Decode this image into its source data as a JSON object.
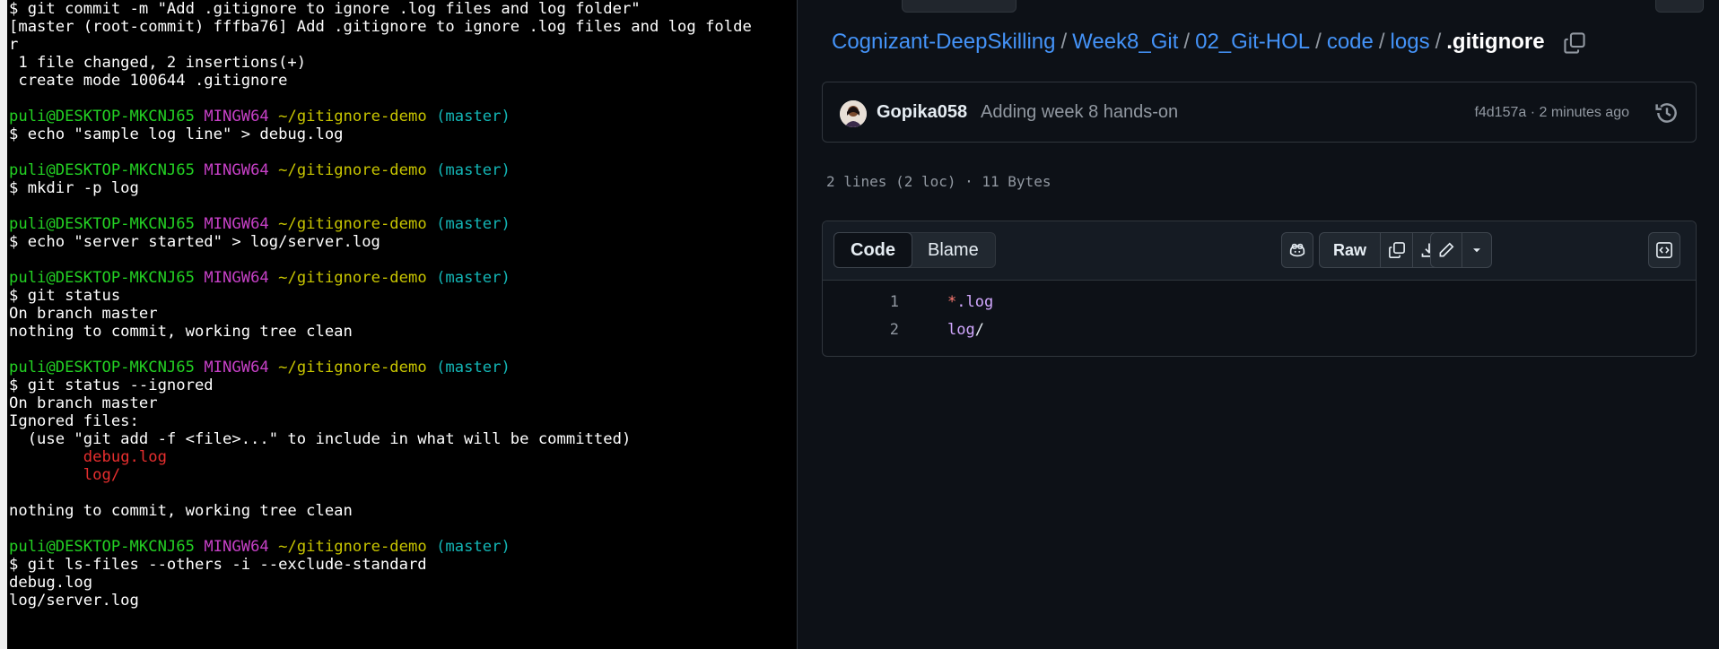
{
  "terminal": {
    "lines": [
      [
        {
          "t": "$ git commit -m \"Add .gitignore to ignore .log files and log folder\"",
          "c": ""
        }
      ],
      [
        {
          "t": "[master (root-commit) fffba76] Add .gitignore to ignore .log files and log folde",
          "c": ""
        }
      ],
      [
        {
          "t": "r",
          "c": ""
        }
      ],
      [
        {
          "t": " 1 file changed, 2 insertions(+)",
          "c": ""
        }
      ],
      [
        {
          "t": " create mode 100644 .gitignore",
          "c": ""
        }
      ],
      [],
      [
        {
          "t": "puli@DESKTOP-MKCNJ65",
          "c": "g"
        },
        {
          "t": " ",
          "c": ""
        },
        {
          "t": "MINGW64",
          "c": "m"
        },
        {
          "t": " ",
          "c": ""
        },
        {
          "t": "~/gitignore-demo",
          "c": "y"
        },
        {
          "t": " ",
          "c": ""
        },
        {
          "t": "(master)",
          "c": "c"
        }
      ],
      [
        {
          "t": "$ echo \"sample log line\" > debug.log",
          "c": ""
        }
      ],
      [],
      [
        {
          "t": "puli@DESKTOP-MKCNJ65",
          "c": "g"
        },
        {
          "t": " ",
          "c": ""
        },
        {
          "t": "MINGW64",
          "c": "m"
        },
        {
          "t": " ",
          "c": ""
        },
        {
          "t": "~/gitignore-demo",
          "c": "y"
        },
        {
          "t": " ",
          "c": ""
        },
        {
          "t": "(master)",
          "c": "c"
        }
      ],
      [
        {
          "t": "$ mkdir -p log",
          "c": ""
        }
      ],
      [],
      [
        {
          "t": "puli@DESKTOP-MKCNJ65",
          "c": "g"
        },
        {
          "t": " ",
          "c": ""
        },
        {
          "t": "MINGW64",
          "c": "m"
        },
        {
          "t": " ",
          "c": ""
        },
        {
          "t": "~/gitignore-demo",
          "c": "y"
        },
        {
          "t": " ",
          "c": ""
        },
        {
          "t": "(master)",
          "c": "c"
        }
      ],
      [
        {
          "t": "$ echo \"server started\" > log/server.log",
          "c": ""
        }
      ],
      [],
      [
        {
          "t": "puli@DESKTOP-MKCNJ65",
          "c": "g"
        },
        {
          "t": " ",
          "c": ""
        },
        {
          "t": "MINGW64",
          "c": "m"
        },
        {
          "t": " ",
          "c": ""
        },
        {
          "t": "~/gitignore-demo",
          "c": "y"
        },
        {
          "t": " ",
          "c": ""
        },
        {
          "t": "(master)",
          "c": "c"
        }
      ],
      [
        {
          "t": "$ git status",
          "c": ""
        }
      ],
      [
        {
          "t": "On branch master",
          "c": ""
        }
      ],
      [
        {
          "t": "nothing to commit, working tree clean",
          "c": ""
        }
      ],
      [],
      [
        {
          "t": "puli@DESKTOP-MKCNJ65",
          "c": "g"
        },
        {
          "t": " ",
          "c": ""
        },
        {
          "t": "MINGW64",
          "c": "m"
        },
        {
          "t": " ",
          "c": ""
        },
        {
          "t": "~/gitignore-demo",
          "c": "y"
        },
        {
          "t": " ",
          "c": ""
        },
        {
          "t": "(master)",
          "c": "c"
        }
      ],
      [
        {
          "t": "$ git status --ignored",
          "c": ""
        }
      ],
      [
        {
          "t": "On branch master",
          "c": ""
        }
      ],
      [
        {
          "t": "Ignored files:",
          "c": ""
        }
      ],
      [
        {
          "t": "  (use \"git add -f <file>...\" to include in what will be committed)",
          "c": ""
        }
      ],
      [
        {
          "t": "        ",
          "c": ""
        },
        {
          "t": "debug.log",
          "c": "r"
        }
      ],
      [
        {
          "t": "        ",
          "c": ""
        },
        {
          "t": "log/",
          "c": "r"
        }
      ],
      [],
      [
        {
          "t": "nothing to commit, working tree clean",
          "c": ""
        }
      ],
      [],
      [
        {
          "t": "puli@DESKTOP-MKCNJ65",
          "c": "g"
        },
        {
          "t": " ",
          "c": ""
        },
        {
          "t": "MINGW64",
          "c": "m"
        },
        {
          "t": " ",
          "c": ""
        },
        {
          "t": "~/gitignore-demo",
          "c": "y"
        },
        {
          "t": " ",
          "c": ""
        },
        {
          "t": "(master)",
          "c": "c"
        }
      ],
      [
        {
          "t": "$ git ls-files --others -i --exclude-standard",
          "c": ""
        }
      ],
      [
        {
          "t": "debug.log",
          "c": ""
        }
      ],
      [
        {
          "t": "log/server.log",
          "c": ""
        }
      ]
    ]
  },
  "github": {
    "breadcrumb": {
      "parts": [
        "Cognizant-DeepSkilling",
        "Week8_Git",
        "02_Git-HOL",
        "code",
        "logs"
      ],
      "separator": "/",
      "file": ".gitignore"
    },
    "commit": {
      "author": "Gopika058",
      "message": "Adding week 8 hands-on",
      "meta": "f4d157a · 2 minutes ago"
    },
    "file_info": "2 lines (2 loc) · 11 Bytes",
    "tabs": {
      "code": "Code",
      "blame": "Blame"
    },
    "toolbar": {
      "raw": "Raw"
    },
    "code": [
      {
        "num": "1",
        "star": "*",
        "rest": ".log",
        "slash": ""
      },
      {
        "num": "2",
        "star": "",
        "rest": "log",
        "slash": "/"
      }
    ]
  }
}
